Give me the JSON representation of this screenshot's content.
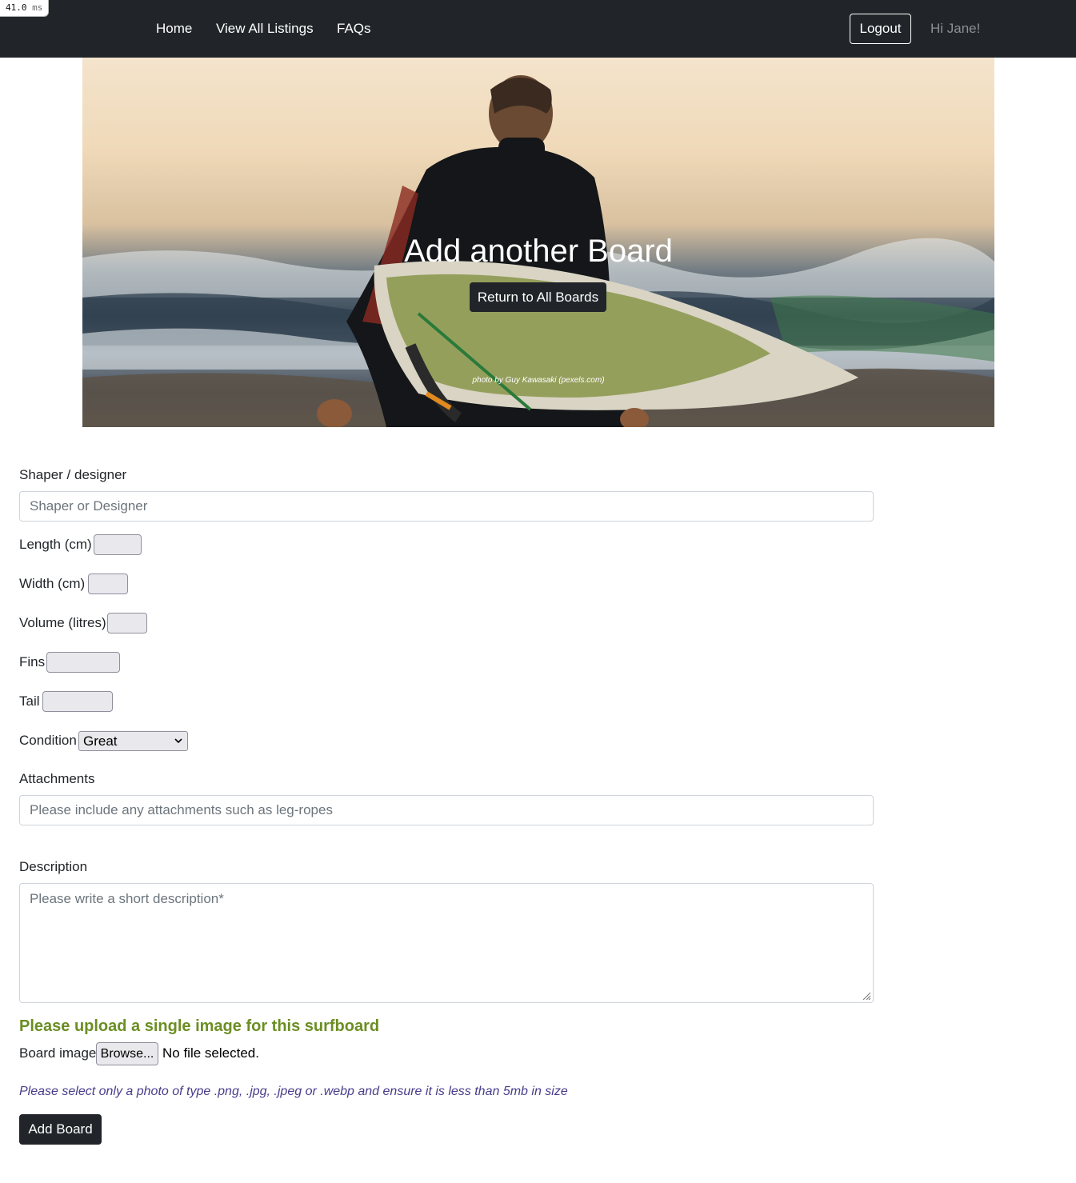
{
  "perf": {
    "value": "41.0",
    "unit": "ms"
  },
  "nav": {
    "home": "Home",
    "listings": "View All Listings",
    "faqs": "FAQs",
    "logout": "Logout",
    "greeting": "Hi Jane!"
  },
  "hero": {
    "title": "Add another Board",
    "button": "Return to All Boards",
    "credit": "photo by Guy Kawasaki (pexels.com)"
  },
  "form": {
    "shaper_label": "Shaper / designer",
    "shaper_placeholder": "Shaper or Designer",
    "length_label": "Length (cm)",
    "width_label": "Width (cm)",
    "volume_label": "Volume (litres)",
    "fins_label": "Fins",
    "tail_label": "Tail",
    "condition_label": "Condition",
    "condition_value": "Great",
    "attachments_label": "Attachments",
    "attachments_placeholder": "Please include any attachments such as leg-ropes",
    "description_label": "Description",
    "description_placeholder": "Please write a short description*",
    "upload_heading": "Please upload a single image for this surfboard",
    "image_label": "Board image",
    "browse": "Browse...",
    "file_status": "No file selected.",
    "hint": "Please select only a photo of type .png, .jpg, .jpeg or .webp and ensure it is less than 5mb in size",
    "submit": "Add Board"
  },
  "colors": {
    "navbar": "#212529",
    "upload_heading": "#6b8e23",
    "hint": "#483d8b"
  }
}
